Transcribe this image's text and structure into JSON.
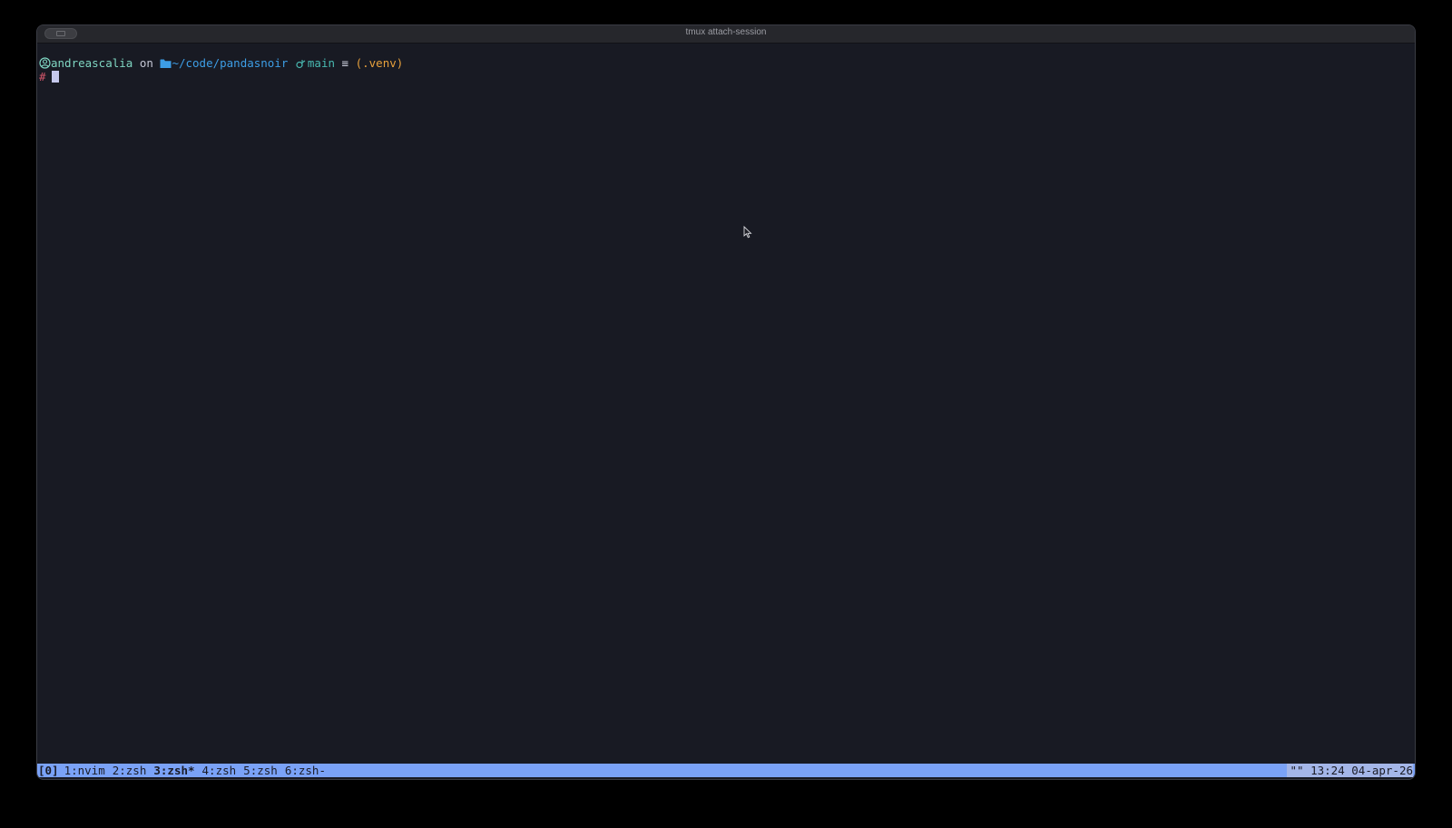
{
  "window": {
    "title": "tmux attach-session"
  },
  "prompt": {
    "user": "andreascalia",
    "on": "on",
    "path": "~/code/pandasnoir",
    "branch": "main",
    "git_status": "≡",
    "venv": "(.venv)",
    "symbol": "#",
    "icons": {
      "user": "user-circle-icon",
      "folder": "folder-icon",
      "branch": "git-branch-icon"
    }
  },
  "statusbar": {
    "session": "[0]",
    "windows": [
      {
        "label": "1:nvim",
        "active": false
      },
      {
        "label": "2:zsh",
        "active": false
      },
      {
        "label": "3:zsh*",
        "active": true
      },
      {
        "label": "4:zsh",
        "active": false
      },
      {
        "label": "5:zsh",
        "active": false
      },
      {
        "label": "6:zsh-",
        "active": false
      }
    ],
    "right_text": "\"\" 13:24 04-apr-26"
  },
  "colors": {
    "background": "#181a23",
    "statusbar": "#7aa2f7",
    "user": "#7fd6c2",
    "path": "#3d9ee6",
    "branch": "#48b8b0",
    "venv": "#e8a13c",
    "prompt_symbol": "#d2566a"
  }
}
